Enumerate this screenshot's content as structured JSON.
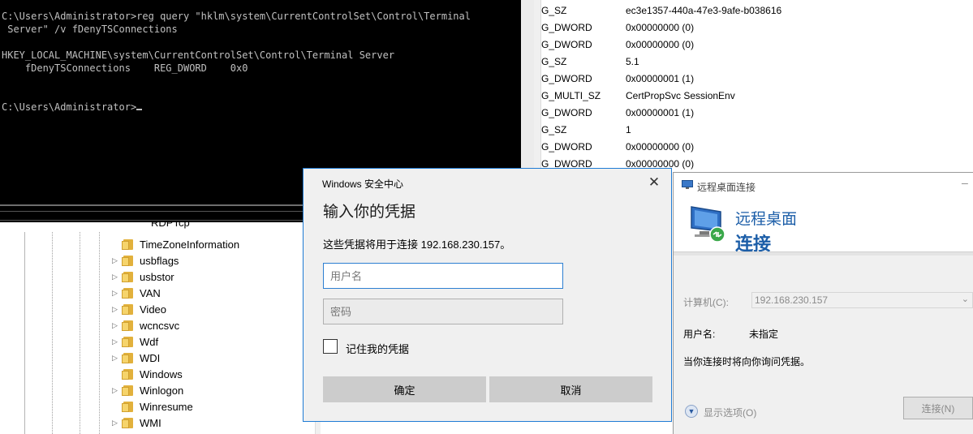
{
  "console": {
    "lines": [
      "C:\\Users\\Administrator>reg query \"hklm\\system\\CurrentControlSet\\Control\\Terminal",
      " Server\" /v fDenyTSConnections",
      "",
      "HKEY_LOCAL_MACHINE\\system\\CurrentControlSet\\Control\\Terminal Server",
      "    fDenyTSConnections    REG_DWORD    0x0",
      "",
      "",
      "C:\\Users\\Administrator>"
    ]
  },
  "registry_values": {
    "rows": [
      {
        "type": "G_SZ",
        "data": "ec3e1357-440a-47e3-9afe-b038616"
      },
      {
        "type": "G_DWORD",
        "data": "0x00000000 (0)"
      },
      {
        "type": "G_DWORD",
        "data": "0x00000000 (0)"
      },
      {
        "type": "G_SZ",
        "data": "5.1"
      },
      {
        "type": "G_DWORD",
        "data": "0x00000001 (1)"
      },
      {
        "type": "G_MULTI_SZ",
        "data": "CertPropSvc SessionEnv"
      },
      {
        "type": "G_DWORD",
        "data": "0x00000001 (1)"
      },
      {
        "type": "G_SZ",
        "data": "1"
      },
      {
        "type": "G_DWORD",
        "data": "0x00000000 (0)"
      },
      {
        "type": "G_DWORD",
        "data": "0x00000000 (0)"
      }
    ]
  },
  "registry_tree": {
    "top_node": "RDPTcp",
    "items": [
      {
        "label": "TimeZoneInformation",
        "expandable": false
      },
      {
        "label": "usbflags",
        "expandable": true
      },
      {
        "label": "usbstor",
        "expandable": true
      },
      {
        "label": "VAN",
        "expandable": true
      },
      {
        "label": "Video",
        "expandable": true
      },
      {
        "label": "wcncsvc",
        "expandable": true
      },
      {
        "label": "Wdf",
        "expandable": true
      },
      {
        "label": "WDI",
        "expandable": true
      },
      {
        "label": "Windows",
        "expandable": false
      },
      {
        "label": "Winlogon",
        "expandable": true
      },
      {
        "label": "Winresume",
        "expandable": false
      },
      {
        "label": "WMI",
        "expandable": true
      }
    ]
  },
  "security_dialog": {
    "title": "Windows 安全中心",
    "heading": "输入你的凭据",
    "description": "这些凭据将用于连接 192.168.230.157。",
    "username_placeholder": "用户名",
    "username_value": "",
    "password_placeholder": "密码",
    "password_value": "",
    "remember_label": "记住我的凭据",
    "remember_checked": false,
    "ok_label": "确定",
    "cancel_label": "取消"
  },
  "rdc": {
    "title": "远程桌面连接",
    "banner_line1": "远程桌面",
    "banner_line2": "连接",
    "computer_label": "计算机(C):",
    "computer_value": "192.168.230.157",
    "username_label": "用户名:",
    "username_value": "未指定",
    "prompt_text": "当你连接时将向你询问凭据。",
    "options_label": "显示选项(O)",
    "connect_label": "连接(N)"
  },
  "colors": {
    "console_bg": "#000000",
    "console_text": "#c0c0c0",
    "rdc_blue": "#1c5ea8",
    "dialog_border": "#1e7bd4",
    "folder_yellow": "#f6d46b"
  }
}
